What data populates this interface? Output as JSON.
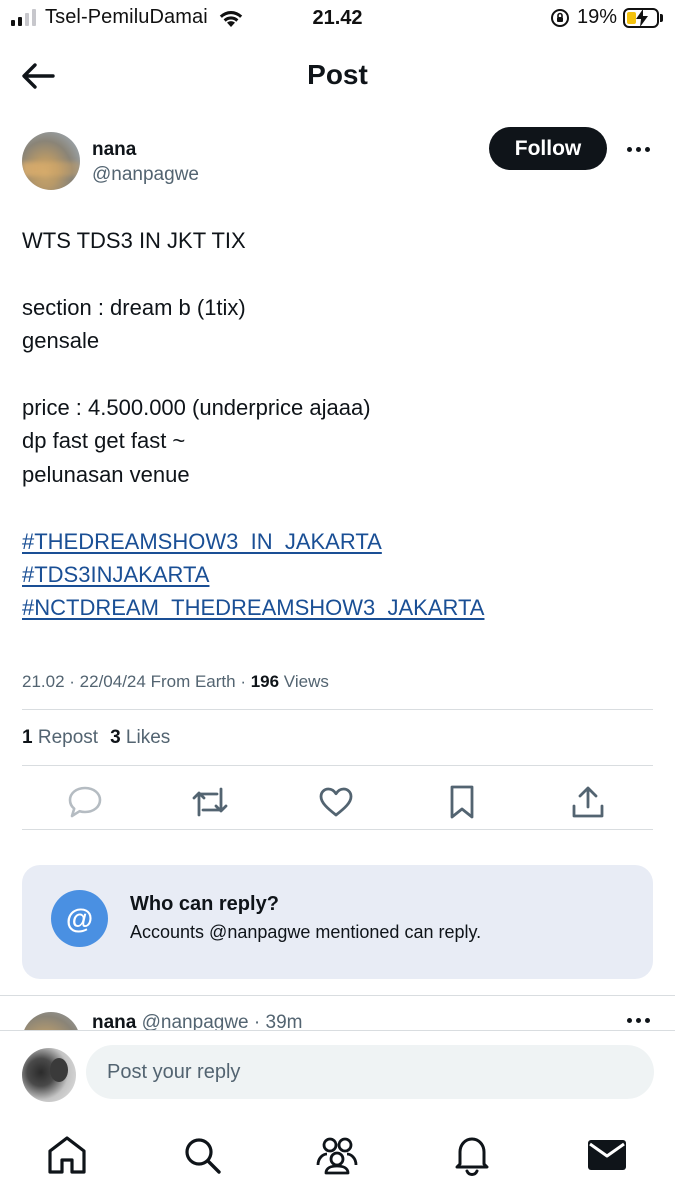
{
  "status_bar": {
    "carrier": "Tsel-PemiluDamai",
    "time": "21.42",
    "battery_percent": "19%",
    "battery_level": 0.19,
    "signal_bars_active": 2,
    "signal_bars_total": 4
  },
  "header": {
    "title": "Post",
    "back_icon": "arrow-left-icon"
  },
  "author": {
    "name": "nana",
    "handle": "@nanpagwe",
    "follow_label": "Follow",
    "more_icon": "ellipsis-icon"
  },
  "tweet": {
    "line1": "WTS TDS3 IN JKT TIX",
    "line2": "section : dream b (1tix)",
    "line3": "gensale",
    "line4": "price : 4.500.000 (underprice ajaaa)",
    "line5": "dp fast get fast ~",
    "line6": "pelunasan venue",
    "hashtags": [
      "#THEDREAMSHOW3_IN_JAKARTA",
      "#TDS3INJAKARTA",
      "#NCTDREAM_THEDREAMSHOW3_JAKARTA"
    ]
  },
  "meta": {
    "time": "21.02",
    "sep1": " · ",
    "date": "22/04/24",
    "location": " From Earth",
    "sep2": " · ",
    "views_count": "196",
    "views_label": " Views"
  },
  "stats": {
    "reposts_count": "1",
    "reposts_label": " Repost",
    "likes_count": "3",
    "likes_label": " Likes"
  },
  "actions": [
    {
      "name": "reply",
      "icon": "comment-icon"
    },
    {
      "name": "repost",
      "icon": "repost-icon"
    },
    {
      "name": "like",
      "icon": "heart-icon"
    },
    {
      "name": "bookmark",
      "icon": "bookmark-icon"
    },
    {
      "name": "share",
      "icon": "share-icon"
    }
  ],
  "reply_card": {
    "icon_glyph": "@",
    "title": "Who can reply?",
    "subtitle": "Accounts @nanpagwe mentioned can reply."
  },
  "next_reply": {
    "name": "nana",
    "handle_time": " @nanpagwe · 39m"
  },
  "compose": {
    "placeholder": "Post your reply"
  },
  "tabbar": [
    {
      "name": "home",
      "icon": "home-icon"
    },
    {
      "name": "search",
      "icon": "search-icon"
    },
    {
      "name": "communities",
      "icon": "people-icon"
    },
    {
      "name": "notifications",
      "icon": "bell-icon"
    },
    {
      "name": "messages",
      "icon": "mail-icon"
    }
  ],
  "colors": {
    "text": "#0f1419",
    "secondary": "#536471",
    "link": "#1a4f95",
    "accent": "#4a90e2",
    "card_bg": "#e8ecf5",
    "divider": "#d9dde0"
  }
}
